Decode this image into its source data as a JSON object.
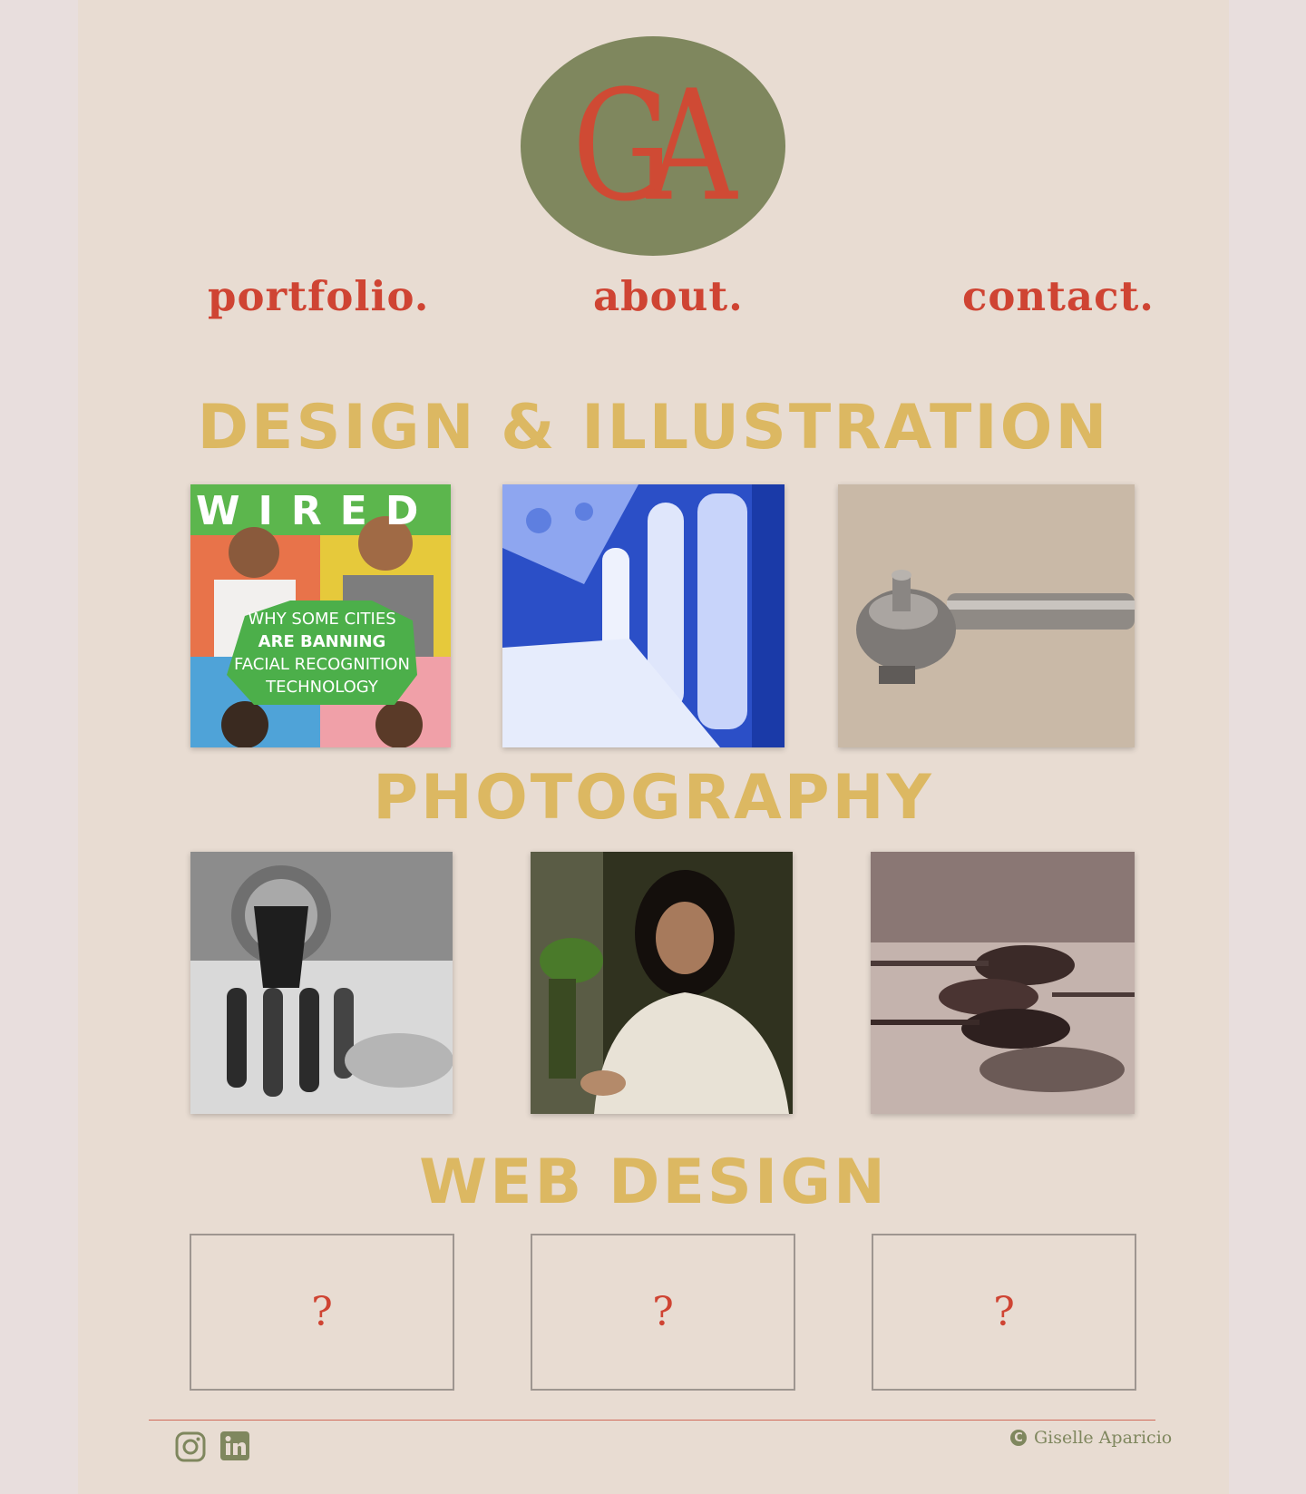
{
  "logo": {
    "letters": "GA"
  },
  "nav": {
    "portfolio": "portfolio.",
    "about": "about.",
    "contact": "contact."
  },
  "sections": {
    "design": "DESIGN & ILLUSTRATION",
    "photography": "PHOTOGRAPHY",
    "web": "WEB DESIGN"
  },
  "wired_cover": {
    "masthead": "WIRED",
    "headline_1": "WHY SOME CITIES",
    "headline_2": "ARE BANNING",
    "headline_3": "FACIAL RECOGNITION",
    "headline_4": "TECHNOLOGY"
  },
  "web_boxes": [
    "?",
    "?",
    "?"
  ],
  "footer": {
    "copyright": "Giselle Aparicio",
    "copyright_symbol": "C"
  },
  "colors": {
    "accent_red": "#cf4433",
    "olive": "#7f875e",
    "gold": "#dcb862",
    "page_bg": "#e8dcd2"
  },
  "icons": [
    "instagram-icon",
    "linkedin-icon",
    "copyright-icon"
  ]
}
